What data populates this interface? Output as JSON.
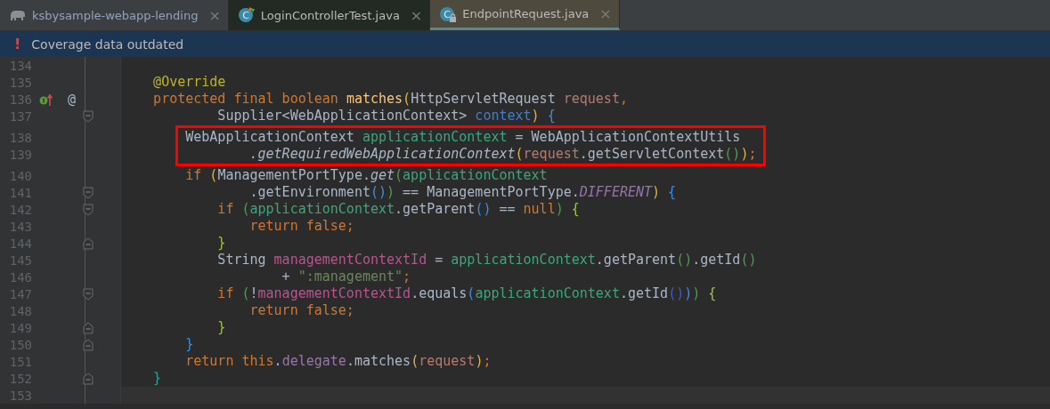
{
  "tabs": [
    {
      "label": "ksbysample-webapp-lending",
      "kind": "project",
      "selected": false,
      "close": "×"
    },
    {
      "label": "LoginControllerTest.java",
      "kind": "test-class",
      "badge": "C",
      "selected": false,
      "close": "×"
    },
    {
      "label": "EndpointRequest.java",
      "kind": "locked-class",
      "badge": "C",
      "selected": true,
      "close": "×"
    }
  ],
  "banner": {
    "mark": "!",
    "text": "Coverage data outdated"
  },
  "editor": {
    "lines": [
      {
        "number": "134"
      },
      {
        "number": "135",
        "tokens": [
          {
            "kind": "annotation",
            "text": "    @Override"
          }
        ]
      },
      {
        "number": "136",
        "gutter": "@",
        "override": true,
        "tokens": [
          {
            "kind": "keyword",
            "text": "    protected final boolean "
          },
          {
            "kind": "method",
            "text": "matches"
          },
          {
            "kind": "p-yellow",
            "text": "("
          },
          {
            "kind": "plain",
            "text": "HttpServletRequest "
          },
          {
            "kind": "param",
            "text": "request"
          },
          {
            "kind": "keyword",
            "text": ","
          }
        ]
      },
      {
        "number": "137",
        "kind": "fold-start",
        "tokens": [
          {
            "kind": "plain",
            "text": "            Supplier<WebApplicationContext> "
          },
          {
            "kind": "unused",
            "text": "context"
          },
          {
            "kind": "p-yellow",
            "text": ")"
          },
          {
            "kind": "p-blue",
            "text": " {"
          }
        ]
      },
      {
        "number": "138",
        "boxed": true,
        "tokens": [
          {
            "kind": "plain",
            "text": "        WebApplicationContext "
          },
          {
            "kind": "local-green",
            "text": "applicationContext"
          },
          {
            "kind": "plain",
            "text": " = WebApplicationContextUtils"
          }
        ]
      },
      {
        "number": "139",
        "boxed": true,
        "tokens": [
          {
            "kind": "static",
            "text": "                .getRequiredWebApplicationContext"
          },
          {
            "kind": "p-yellow",
            "text": "("
          },
          {
            "kind": "param",
            "text": "request"
          },
          {
            "kind": "plain",
            "text": ".getServletContext"
          },
          {
            "kind": "p-green",
            "text": "()"
          },
          {
            "kind": "p-yellow",
            "text": ")"
          },
          {
            "kind": "keyword",
            "text": ";"
          }
        ]
      },
      {
        "number": "140",
        "tokens": [
          {
            "kind": "keyword",
            "text": "        if "
          },
          {
            "kind": "p-yellow",
            "text": "("
          },
          {
            "kind": "plain",
            "text": "ManagementPortType."
          },
          {
            "kind": "static",
            "text": "get"
          },
          {
            "kind": "p-green",
            "text": "("
          },
          {
            "kind": "local-green",
            "text": "applicationContext"
          }
        ]
      },
      {
        "number": "141",
        "kind": "fold-start",
        "tokens": [
          {
            "kind": "plain",
            "text": "                .getEnvironment"
          },
          {
            "kind": "p-blue",
            "text": "()"
          },
          {
            "kind": "p-green",
            "text": ")"
          },
          {
            "kind": "plain",
            "text": " == ManagementPortType."
          },
          {
            "kind": "constant",
            "text": "DIFFERENT"
          },
          {
            "kind": "p-yellow",
            "text": ")"
          },
          {
            "kind": "p-blue",
            "text": " {"
          }
        ]
      },
      {
        "number": "142",
        "kind": "fold-start",
        "tokens": [
          {
            "kind": "keyword",
            "text": "            if "
          },
          {
            "kind": "p-green",
            "text": "("
          },
          {
            "kind": "local-green",
            "text": "applicationContext"
          },
          {
            "kind": "plain",
            "text": ".getParent"
          },
          {
            "kind": "p-blue",
            "text": "()"
          },
          {
            "kind": "plain",
            "text": " == "
          },
          {
            "kind": "keyword",
            "text": "null"
          },
          {
            "kind": "p-green",
            "text": ")"
          },
          {
            "kind": "p-lime",
            "text": " {"
          }
        ]
      },
      {
        "number": "143",
        "tokens": [
          {
            "kind": "keyword",
            "text": "                return false;"
          }
        ]
      },
      {
        "number": "144",
        "kind": "fold-end",
        "tokens": [
          {
            "kind": "p-lime",
            "text": "            }"
          }
        ]
      },
      {
        "number": "145",
        "tokens": [
          {
            "kind": "plain",
            "text": "            String "
          },
          {
            "kind": "local-pink",
            "text": "managementContextId"
          },
          {
            "kind": "plain",
            "text": " = "
          },
          {
            "kind": "local-green",
            "text": "applicationContext"
          },
          {
            "kind": "plain",
            "text": ".getParent"
          },
          {
            "kind": "p-green",
            "text": "()"
          },
          {
            "kind": "plain",
            "text": ".getId"
          },
          {
            "kind": "p-green",
            "text": "()"
          }
        ]
      },
      {
        "number": "146",
        "tokens": [
          {
            "kind": "plain",
            "text": "                    + "
          },
          {
            "kind": "string",
            "text": "\":management\""
          },
          {
            "kind": "keyword",
            "text": ";"
          }
        ]
      },
      {
        "number": "147",
        "kind": "fold-start",
        "tokens": [
          {
            "kind": "keyword",
            "text": "            if "
          },
          {
            "kind": "p-green",
            "text": "("
          },
          {
            "kind": "plain",
            "text": "!"
          },
          {
            "kind": "local-pink",
            "text": "managementContextId"
          },
          {
            "kind": "plain",
            "text": ".equals"
          },
          {
            "kind": "p-blue",
            "text": "("
          },
          {
            "kind": "local-green",
            "text": "applicationContext"
          },
          {
            "kind": "plain",
            "text": ".getId"
          },
          {
            "kind": "p-navy",
            "text": "()"
          },
          {
            "kind": "p-blue",
            "text": ")"
          },
          {
            "kind": "p-green",
            "text": ")"
          },
          {
            "kind": "p-lime",
            "text": " {"
          }
        ]
      },
      {
        "number": "148",
        "tokens": [
          {
            "kind": "keyword",
            "text": "                return false;"
          }
        ]
      },
      {
        "number": "149",
        "kind": "fold-end",
        "tokens": [
          {
            "kind": "p-lime",
            "text": "            }"
          }
        ]
      },
      {
        "number": "150",
        "kind": "fold-end",
        "tokens": [
          {
            "kind": "p-blue",
            "text": "        }"
          }
        ]
      },
      {
        "number": "151",
        "tokens": [
          {
            "kind": "keyword",
            "text": "        return this"
          },
          {
            "kind": "plain",
            "text": "."
          },
          {
            "kind": "field",
            "text": "delegate"
          },
          {
            "kind": "plain",
            "text": ".matches"
          },
          {
            "kind": "p-yellow",
            "text": "("
          },
          {
            "kind": "param",
            "text": "request"
          },
          {
            "kind": "p-yellow",
            "text": ")"
          },
          {
            "kind": "keyword",
            "text": ";"
          }
        ]
      },
      {
        "number": "152",
        "kind": "fold-end",
        "tokens": [
          {
            "kind": "p-teal",
            "text": "    }"
          }
        ]
      },
      {
        "number": "153",
        "current": true
      }
    ]
  }
}
